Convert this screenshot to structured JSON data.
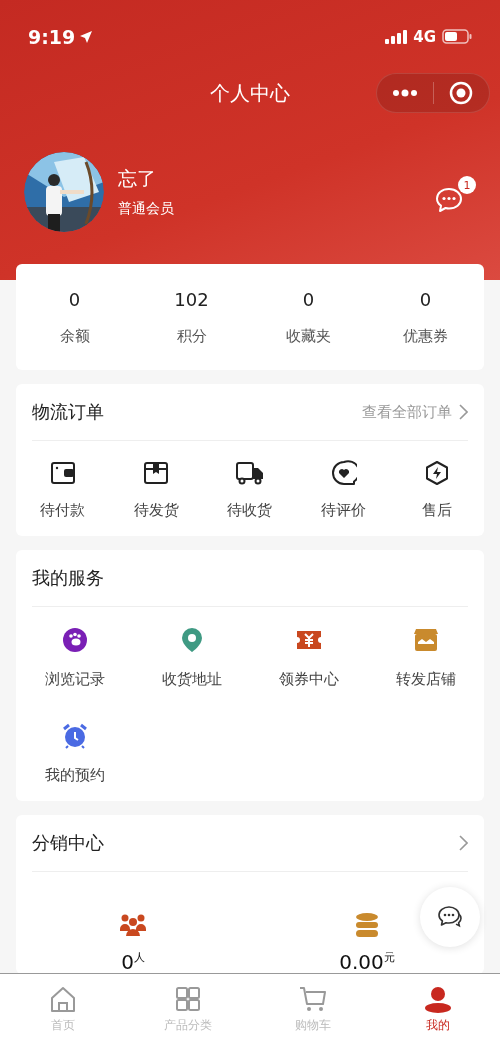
{
  "status_bar": {
    "time": "9:19",
    "network": "4G"
  },
  "header": {
    "title": "个人中心"
  },
  "profile": {
    "name": "忘了",
    "level": "普通会员",
    "message_badge": "1"
  },
  "stats": [
    {
      "value": "0",
      "label": "余额"
    },
    {
      "value": "102",
      "label": "积分"
    },
    {
      "value": "0",
      "label": "收藏夹"
    },
    {
      "value": "0",
      "label": "优惠券"
    }
  ],
  "orders": {
    "title": "物流订单",
    "link": "查看全部订单",
    "items": [
      {
        "kind": "wallet",
        "label": "待付款"
      },
      {
        "kind": "box",
        "label": "待发货"
      },
      {
        "kind": "truck",
        "label": "待收货"
      },
      {
        "kind": "review",
        "label": "待评价"
      },
      {
        "kind": "aftersale",
        "label": "售后"
      }
    ]
  },
  "services": {
    "title": "我的服务",
    "items": [
      {
        "kind": "footprint",
        "label": "浏览记录"
      },
      {
        "kind": "pin",
        "label": "收货地址"
      },
      {
        "kind": "coupon",
        "label": "领券中心"
      },
      {
        "kind": "store",
        "label": "转发店铺"
      },
      {
        "kind": "alarm",
        "label": "我的预约"
      }
    ]
  },
  "distribution": {
    "title": "分销中心",
    "items": [
      {
        "kind": "people",
        "value": "0$^{人}$"
      },
      {
        "kind": "coins",
        "value": "0.00$^{元}$"
      }
    ]
  },
  "tab_bar": [
    {
      "kind": "home",
      "label": "首页",
      "selected": false
    },
    {
      "kind": "grid",
      "label": "产品分类",
      "selected": false
    },
    {
      "kind": "cart",
      "label": "购物车",
      "selected": false
    },
    {
      "kind": "person",
      "label": "我的",
      "selected": true
    }
  ]
}
